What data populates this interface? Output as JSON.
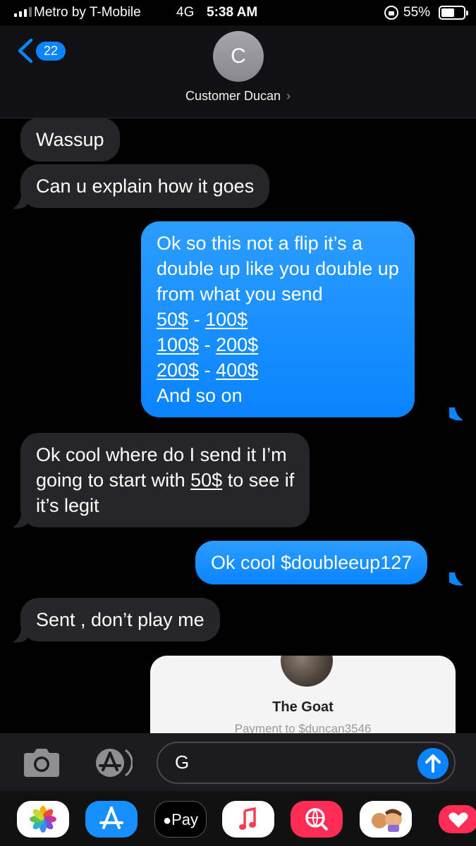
{
  "status_bar": {
    "carrier": "Metro by T-Mobile",
    "network": "4G",
    "time": "5:38 AM",
    "battery": "55%"
  },
  "header": {
    "back_badge": "22",
    "avatar_initial": "C",
    "contact_name": "Customer Ducan"
  },
  "messages": [
    {
      "direction": "in",
      "lines": [
        [
          "Wassup"
        ]
      ]
    },
    {
      "direction": "in",
      "lines": [
        [
          "Can u explain how it goes"
        ]
      ]
    },
    {
      "direction": "out",
      "lines": [
        [
          "Ok so this not a flip it’s a"
        ],
        [
          "double up like you double up"
        ],
        [
          "from what you send"
        ],
        [
          {
            "u": "50$"
          },
          " - ",
          {
            "u": "100$"
          }
        ],
        [
          {
            "u": "100$"
          },
          " - ",
          {
            "u": "200$"
          }
        ],
        [
          {
            "u": "200$"
          },
          " - ",
          {
            "u": "400$"
          }
        ],
        [
          "And so on"
        ]
      ]
    },
    {
      "direction": "in",
      "lines": [
        [
          "Ok cool where do I send it I’m"
        ],
        [
          "going to start with ",
          {
            "u": "50$"
          },
          " to see if"
        ],
        [
          "it’s legit"
        ]
      ]
    },
    {
      "direction": "out",
      "lines": [
        [
          "Ok cool $doubleeup127"
        ]
      ]
    },
    {
      "direction": "in",
      "lines": [
        [
          "Sent , don’t play me"
        ]
      ]
    }
  ],
  "payment_card": {
    "name": "The Goat",
    "subtitle": "Payment to $duncan3546"
  },
  "compose": {
    "value": "G"
  },
  "app_drawer": {
    "apple_pay_label": "Pay",
    "apps": [
      "photos-icon",
      "app-store-icon",
      "apple-pay-icon",
      "music-icon",
      "web-search-icon",
      "memoji-icon",
      "digital-touch-icon"
    ]
  },
  "colors": {
    "incoming_bubble": "#262629",
    "outgoing_bubble": "#0a84ff",
    "accent": "#0a84ff",
    "background": "#000000"
  }
}
